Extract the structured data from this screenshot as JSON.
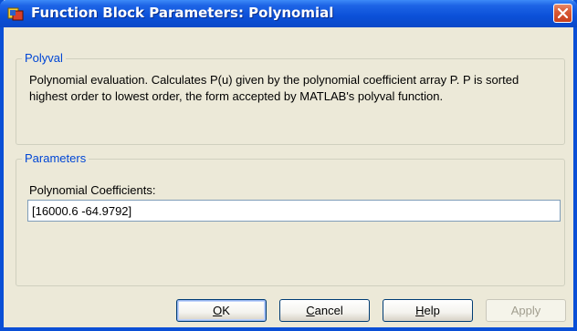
{
  "window": {
    "title": "Function Block Parameters: Polynomial"
  },
  "polyval_group": {
    "label": "Polyval",
    "description": "Polynomial evaluation.  Calculates P(u) given by the polynomial coefficient array P. P is sorted highest order to lowest order, the form accepted by MATLAB's polyval function."
  },
  "parameters_group": {
    "label": "Parameters",
    "coefficients_label": "Polynomial Coefficients:",
    "coefficients_value": "[16000.6 -64.9792]"
  },
  "buttons": {
    "ok": {
      "hotkey": "O",
      "rest": "K"
    },
    "cancel": {
      "hotkey": "C",
      "rest": "ancel"
    },
    "help": {
      "hotkey": "H",
      "rest": "elp"
    },
    "apply": {
      "label": "Apply"
    }
  },
  "colors": {
    "title_bar": "#0a50d8",
    "dialog_bg": "#ece9d8",
    "group_label": "#0046d5",
    "close_button": "#d85a36"
  },
  "icons": {
    "title": "simulink-block-icon",
    "close": "close-icon"
  }
}
